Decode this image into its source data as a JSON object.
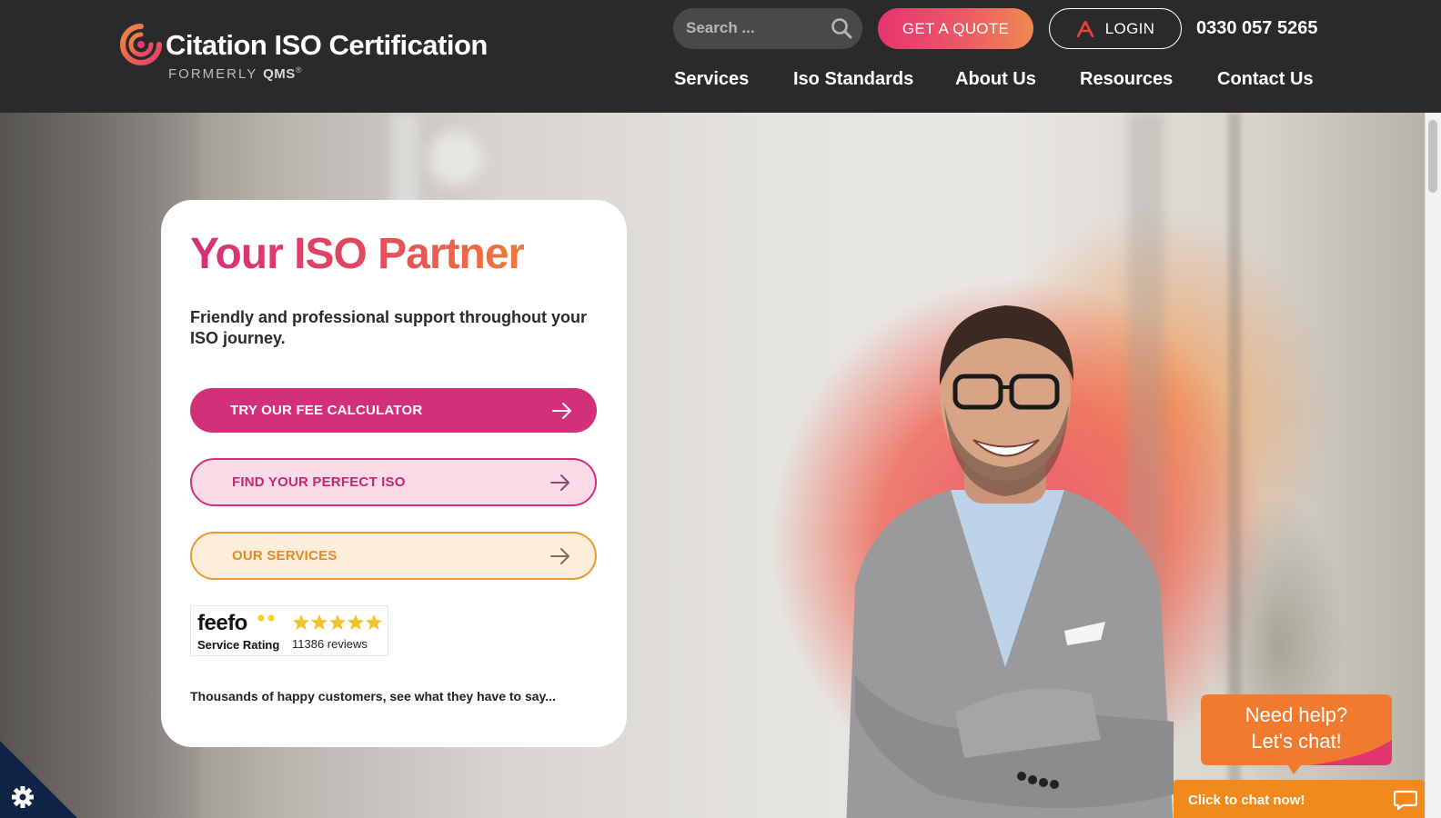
{
  "header": {
    "brand": {
      "name": "Citation ISO Certification",
      "formerly": "FORMERLY",
      "formerly_brand": "QMS",
      "registered": "®"
    },
    "search": {
      "placeholder": "Search ..."
    },
    "quote_button": "GET A QUOTE",
    "login_button": "LOGIN",
    "phone": "0330 057 5265",
    "nav": [
      {
        "label": "Services"
      },
      {
        "label": "Iso Standards"
      },
      {
        "label": "About Us"
      },
      {
        "label": "Resources"
      },
      {
        "label": "Contact Us"
      }
    ]
  },
  "hero_card": {
    "title": "Your ISO Partner",
    "subtitle": "Friendly and professional support throughout your ISO journey.",
    "ctas": [
      {
        "label": "TRY OUR FEE CALCULATOR"
      },
      {
        "label": "FIND YOUR PERFECT ISO"
      },
      {
        "label": "OUR SERVICES"
      }
    ],
    "feefo": {
      "logo": "feefo",
      "label": "Service Rating",
      "reviews": "11386 reviews",
      "stars": 5
    },
    "footer": "Thousands of happy customers, see what they have to say..."
  },
  "chat": {
    "bubble_line1": "Need help?",
    "bubble_line2": "Let's chat!",
    "bar": "Click to chat now!"
  },
  "colors": {
    "header_bg": "#2b2a2b",
    "brand_pink": "#d3307a",
    "brand_orange": "#ef7a3a",
    "chat_orange": "#f08a1c"
  },
  "icons": [
    "citation-logo-icon",
    "search-icon",
    "login-icon",
    "arrow-right-icon",
    "star-icon",
    "chat-icon",
    "settings-gear-icon"
  ]
}
